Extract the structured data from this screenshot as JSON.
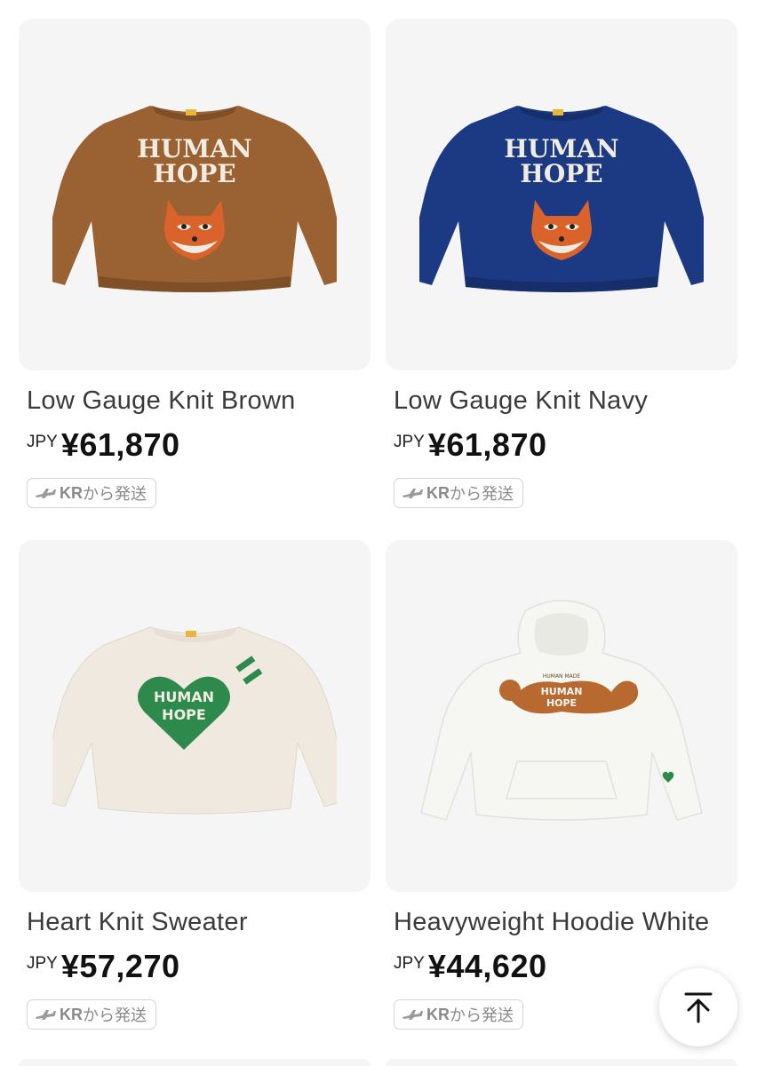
{
  "products": [
    {
      "name": "Low Gauge Knit Brown",
      "currency": "JPY",
      "price": "¥61,870",
      "shipping_origin": "KR",
      "shipping_suffix": "から発送",
      "graphic_text": [
        "HUMAN",
        "HOPE"
      ],
      "colors": {
        "body": "#9a6233",
        "trim": "#7f4f27",
        "graphic": "#f1ece1"
      }
    },
    {
      "name": "Low Gauge Knit Navy",
      "currency": "JPY",
      "price": "¥61,870",
      "shipping_origin": "KR",
      "shipping_suffix": "から発送",
      "graphic_text": [
        "HUMAN",
        "HOPE"
      ],
      "colors": {
        "body": "#1c3a83",
        "trim": "#162f6b",
        "graphic": "#f1ece1"
      }
    },
    {
      "name": "Heart Knit Sweater",
      "currency": "JPY",
      "price": "¥57,270",
      "shipping_origin": "KR",
      "shipping_suffix": "から発送",
      "graphic_text": [
        "HUMAN",
        "HOPE"
      ],
      "colors": {
        "body": "#efe9df",
        "trim": "#e6dfd2",
        "graphic": "#2e8a4c"
      }
    },
    {
      "name": "Heavyweight Hoodie White",
      "currency": "JPY",
      "price": "¥44,620",
      "shipping_origin": "KR",
      "shipping_suffix": "から発送",
      "graphic_text": [
        "HUMAN MADE",
        "HUMAN",
        "HOPE"
      ],
      "colors": {
        "body": "#f6f6f3",
        "trim": "#e9e9e4",
        "graphic": "#b8692f"
      }
    }
  ],
  "scroll_top": {
    "icon": "arrow-up-to-line-icon"
  }
}
